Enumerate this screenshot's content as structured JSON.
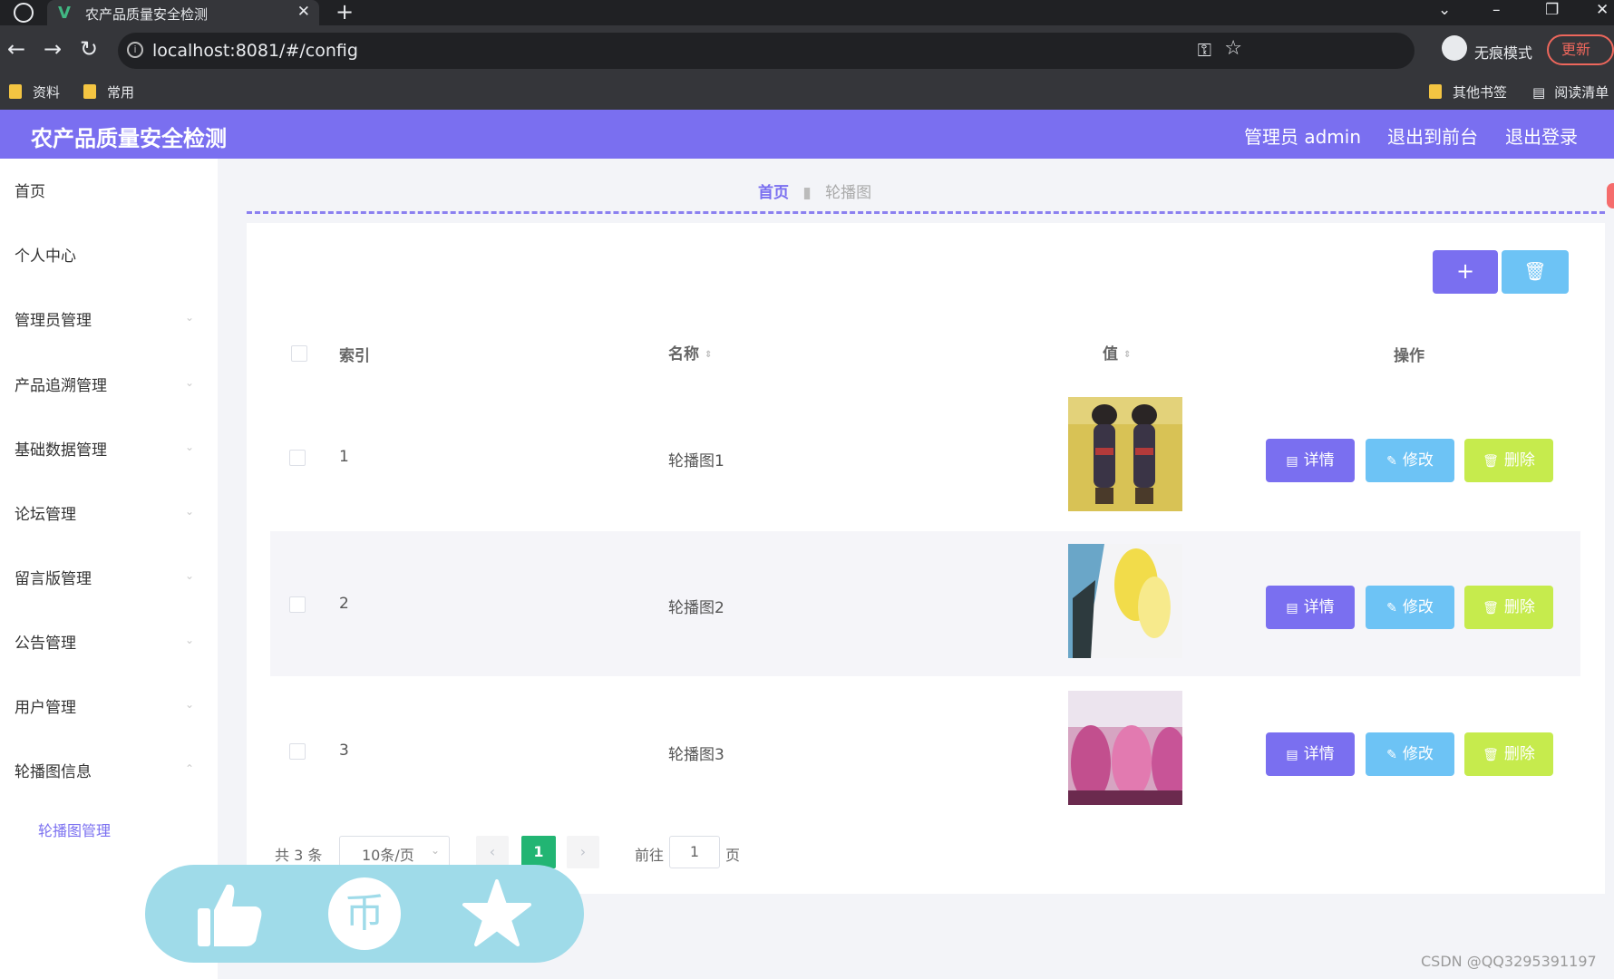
{
  "browser": {
    "tab_title": "农产品质量安全检测",
    "tab_logo": "V",
    "tab_close": "✕",
    "new_tab": "+",
    "url": "localhost:8081/#/config",
    "incognito_label": "无痕模式",
    "update_label": "更新",
    "bookmarks": [
      "资料",
      "常用"
    ],
    "other_bookmarks": "其他书签",
    "reading_list": "阅读清单",
    "icons": {
      "back": "arrow-left",
      "forward": "arrow-right",
      "reload": "reload",
      "info": "i",
      "key": "key",
      "star": "star"
    }
  },
  "header": {
    "title": "农产品质量安全检测",
    "admin": "管理员 admin",
    "to_front": "退出到前台",
    "logout": "退出登录",
    "color": "#7a6ff0"
  },
  "sidebar": {
    "items": [
      {
        "label": "首页"
      },
      {
        "label": "个人中心"
      },
      {
        "label": "管理员管理"
      },
      {
        "label": "产品追溯管理"
      },
      {
        "label": "基础数据管理"
      },
      {
        "label": "论坛管理"
      },
      {
        "label": "留言版管理"
      },
      {
        "label": "公告管理"
      },
      {
        "label": "用户管理"
      },
      {
        "label": "轮播图信息"
      }
    ],
    "active_sub": "轮播图管理"
  },
  "breadcrumb": {
    "home": "首页",
    "current": "轮播图"
  },
  "toolbar": {
    "add_icon": "+",
    "delete_icon": "trash-icon"
  },
  "table": {
    "columns": {
      "index": "索引",
      "name": "名称",
      "value": "值",
      "actions": "操作"
    },
    "rows": [
      {
        "index": "1",
        "name": "轮播图1",
        "image": "轮播图1"
      },
      {
        "index": "2",
        "name": "轮播图2",
        "image": "轮播图2"
      },
      {
        "index": "3",
        "name": "轮播图3",
        "image": "轮播图3"
      }
    ],
    "actions": {
      "detail": "详情",
      "edit": "修改",
      "delete": "删除"
    }
  },
  "pagination": {
    "total": "共 3 条",
    "page_size": "10条/页",
    "current": "1",
    "goto_label": "前往",
    "goto_value": "1",
    "page_suffix": "页"
  },
  "overlay": {
    "icons": [
      "thumbs-up",
      "coin",
      "star"
    ],
    "coin_glyph": "币"
  },
  "watermark": "CSDN @QQ3295391197"
}
